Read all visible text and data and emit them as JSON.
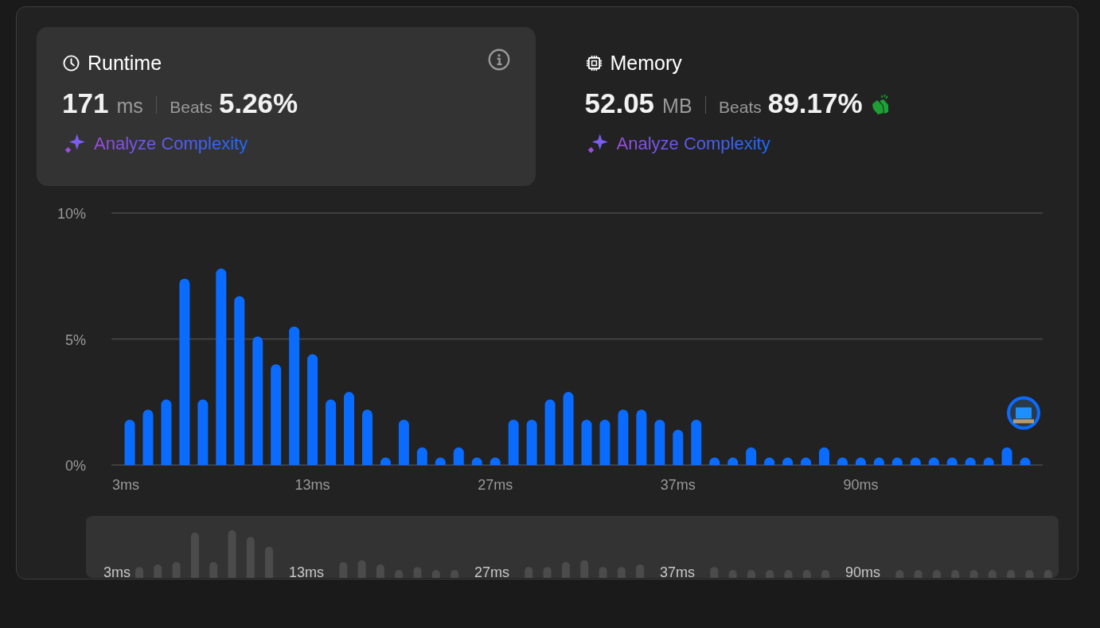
{
  "cards": [
    {
      "kind": "runtime",
      "title": "Runtime",
      "selected": true,
      "info": true,
      "value": "171",
      "unit": "ms",
      "beats_label": "Beats",
      "beats": "5.26%",
      "clap": false,
      "link": "Analyze Complexity"
    },
    {
      "kind": "memory",
      "title": "Memory",
      "selected": false,
      "info": false,
      "value": "52.05",
      "unit": "MB",
      "beats_label": "Beats",
      "beats": "89.17%",
      "clap": true,
      "link": "Analyze Complexity"
    }
  ],
  "chart_data": {
    "type": "bar",
    "categories": [
      "3ms",
      null,
      null,
      null,
      null,
      null,
      null,
      null,
      null,
      null,
      "13ms",
      null,
      null,
      null,
      null,
      null,
      null,
      null,
      null,
      null,
      "27ms",
      null,
      null,
      null,
      null,
      null,
      null,
      null,
      null,
      null,
      "37ms",
      null,
      null,
      null,
      null,
      null,
      null,
      null,
      null,
      null,
      "90ms",
      null,
      null,
      null,
      null,
      null,
      null,
      null,
      null,
      null
    ],
    "series": [
      {
        "color": "#0a6cff",
        "values": [
          1.8,
          2.2,
          2.6,
          7.4,
          2.6,
          7.8,
          6.7,
          5.1,
          4.0,
          5.5,
          4.4,
          2.6,
          2.9,
          2.2,
          0.3,
          1.8,
          0.7,
          0.3,
          0.7,
          0.3,
          0.3,
          1.8,
          1.8,
          2.6,
          2.9,
          1.8,
          1.8,
          2.2,
          2.2,
          1.8,
          1.4,
          1.8,
          0.3,
          0.3,
          0.7,
          0.3,
          0.3,
          0.3,
          0.7,
          0.3,
          0.3,
          0.3,
          0.3,
          0.3,
          0.3,
          0.3,
          0.3,
          0.3,
          0.7,
          0.3
        ]
      }
    ],
    "ylim": [
      0,
      10
    ],
    "yticks": [
      {
        "value": 0,
        "label": "0%"
      },
      {
        "value": 5,
        "label": "5%"
      },
      {
        "value": 10,
        "label": "10%"
      }
    ]
  },
  "brush": {
    "labels": [
      "3ms",
      "13ms",
      "27ms",
      "37ms",
      "90ms"
    ]
  }
}
